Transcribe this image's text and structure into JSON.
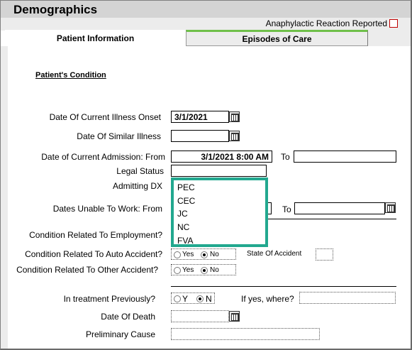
{
  "window": {
    "title": "Demographics"
  },
  "header": {
    "anaphylactic_label": "Anaphylactic Reaction Reported"
  },
  "tabs": [
    {
      "label": "Patient Information",
      "active": true
    },
    {
      "label": "Episodes of Care",
      "active": false
    }
  ],
  "section": {
    "title": "Patient's Condition"
  },
  "fields": {
    "illness_onset": {
      "label": "Date Of Current Illness Onset",
      "value": "3/1/2021"
    },
    "similar_illness": {
      "label": "Date Of Similar Illness",
      "value": ""
    },
    "admission": {
      "label": "Date of Current Admission:  From",
      "value": "3/1/2021 8:00 AM",
      "to_label": "To",
      "to_value": ""
    },
    "legal_status": {
      "label": "Legal Status",
      "value": ""
    },
    "admitting_dx": {
      "label": "Admitting DX"
    },
    "unable_work": {
      "label": "Dates Unable To Work:  From",
      "to_label": "To",
      "to_value": ""
    },
    "employment": {
      "label": "Condition Related To Employment?"
    },
    "auto": {
      "label": "Condition Related To Auto Accident?",
      "yes": "Yes",
      "no": "No",
      "selected": "No",
      "state_label": "State Of Accident",
      "state_value": ""
    },
    "other": {
      "label": "Condition Related To Other Accident?",
      "yes": "Yes",
      "no": "No",
      "selected": "No"
    },
    "prev_treatment": {
      "label": "In treatment Previously?",
      "yes": "Y",
      "no": "N",
      "selected": "N",
      "where_label": "If yes, where?",
      "where_value": ""
    },
    "date_of_death": {
      "label": "Date Of Death",
      "value": ""
    },
    "preliminary_cause": {
      "label": "Preliminary Cause",
      "value": ""
    }
  },
  "dropdown": {
    "options": [
      "PEC",
      "CEC",
      "JC",
      "NC",
      "FVA"
    ]
  },
  "colors": {
    "highlight": "#22a88f",
    "tab_accent": "#6fc04a",
    "checkbox_border": "#c00000"
  }
}
